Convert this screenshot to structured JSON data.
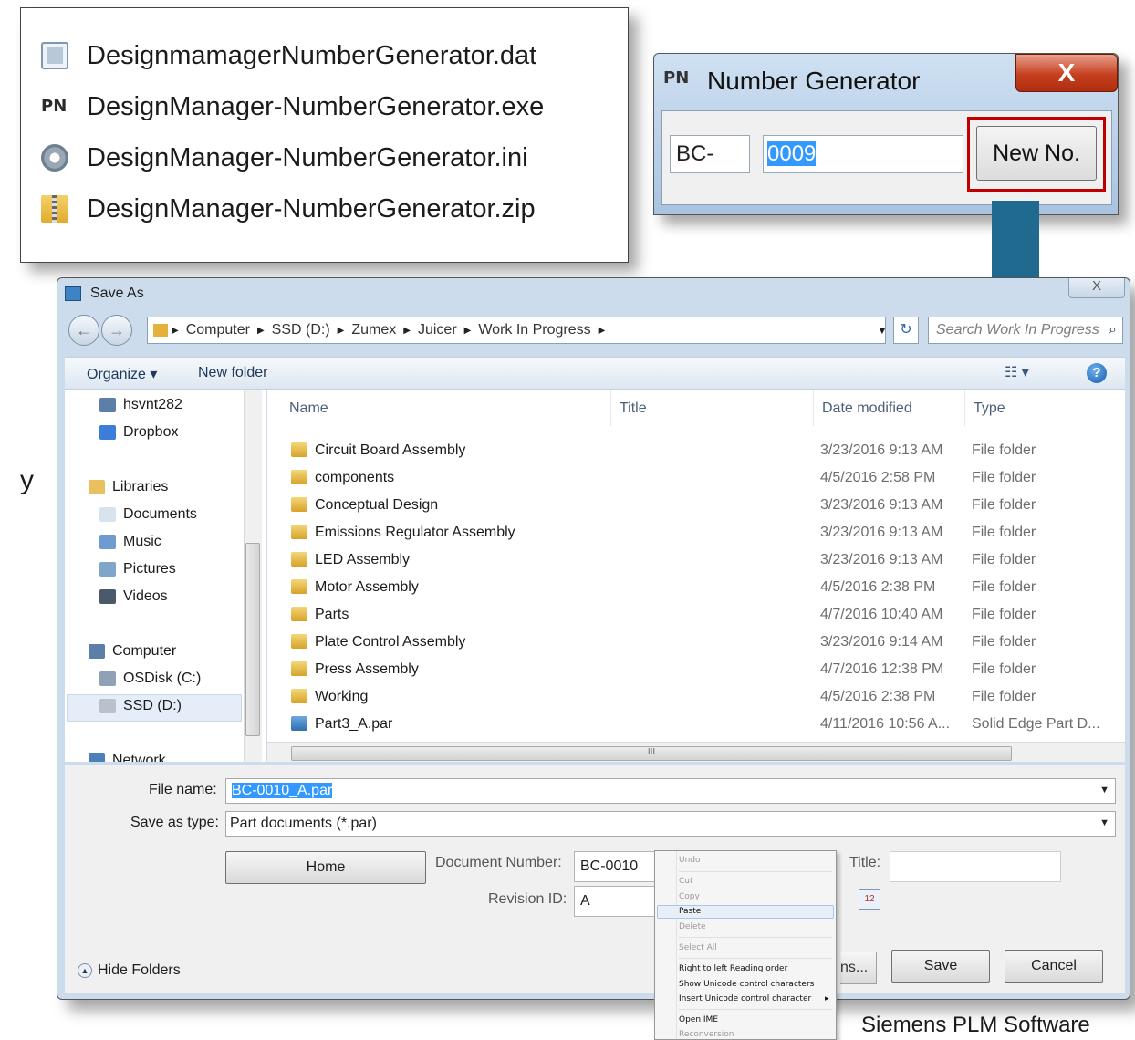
{
  "files": [
    {
      "name": "DesignmamagerNumberGenerator.dat",
      "icon": "dat-file-icon"
    },
    {
      "name": "DesignManager-NumberGenerator.exe",
      "icon": "pn-app-icon"
    },
    {
      "name": "DesignManager-NumberGenerator.ini",
      "icon": "settings-file-icon"
    },
    {
      "name": "DesignManager-NumberGenerator.zip",
      "icon": "zip-folder-icon"
    }
  ],
  "number_generator": {
    "title": "Number Generator",
    "logo": "PN",
    "close": "X",
    "prefix": "BC-",
    "number": "0009",
    "new_button": "New No."
  },
  "save_as": {
    "title": "Save As",
    "close": "X",
    "breadcrumb": [
      "Computer",
      "SSD (D:)",
      "Zumex",
      "Juicer",
      "Work In Progress"
    ],
    "search_placeholder": "Search Work In Progress",
    "toolbar": {
      "organize": "Organize ▾",
      "new_folder": "New folder"
    },
    "nav": [
      {
        "label": "hsvnt282"
      },
      {
        "label": "Dropbox"
      },
      {
        "label": "Libraries"
      },
      {
        "label": "Documents"
      },
      {
        "label": "Music"
      },
      {
        "label": "Pictures"
      },
      {
        "label": "Videos"
      },
      {
        "label": "Computer"
      },
      {
        "label": "OSDisk (C:)"
      },
      {
        "label": "SSD (D:)"
      },
      {
        "label": "Network"
      }
    ],
    "columns": {
      "name": "Name",
      "title": "Title",
      "date": "Date modified",
      "type": "Type"
    },
    "rows": [
      {
        "name": "Circuit Board Assembly",
        "date": "3/23/2016 9:13 AM",
        "type": "File folder"
      },
      {
        "name": "components",
        "date": "4/5/2016 2:58 PM",
        "type": "File folder"
      },
      {
        "name": "Conceptual Design",
        "date": "3/23/2016 9:13 AM",
        "type": "File folder"
      },
      {
        "name": "Emissions Regulator Assembly",
        "date": "3/23/2016 9:13 AM",
        "type": "File folder"
      },
      {
        "name": "LED Assembly",
        "date": "3/23/2016 9:13 AM",
        "type": "File folder"
      },
      {
        "name": "Motor Assembly",
        "date": "4/5/2016 2:38 PM",
        "type": "File folder"
      },
      {
        "name": "Parts",
        "date": "4/7/2016 10:40 AM",
        "type": "File folder"
      },
      {
        "name": "Plate Control Assembly",
        "date": "3/23/2016 9:14 AM",
        "type": "File folder"
      },
      {
        "name": "Press Assembly",
        "date": "4/7/2016 12:38 PM",
        "type": "File folder"
      },
      {
        "name": "Working",
        "date": "4/5/2016 2:38 PM",
        "type": "File folder"
      },
      {
        "name": "Part3_A.par",
        "date": "4/11/2016 10:56 A...",
        "type": "Solid Edge Part D..."
      }
    ],
    "hscroll_grip": "III",
    "file_name_label": "File name:",
    "file_name": "BC-0010_A.par",
    "save_type_label": "Save as type:",
    "save_type": "Part documents (*.par)",
    "home_button": "Home",
    "doc_number_label": "Document Number:",
    "doc_number": "BC-0010",
    "revision_label": "Revision ID:",
    "revision": "A",
    "title_label": "Title:",
    "title_value": "",
    "tools_button": "ns...",
    "save_button": "Save",
    "cancel_button": "Cancel",
    "hide_folders": "Hide Folders"
  },
  "context_menu": [
    {
      "label": "Undo",
      "enabled": false
    },
    {
      "label": "Cut",
      "enabled": false
    },
    {
      "label": "Copy",
      "enabled": false
    },
    {
      "label": "Paste",
      "enabled": true
    },
    {
      "label": "Delete",
      "enabled": false
    },
    {
      "label": "Select All",
      "enabled": false
    },
    {
      "label": "Right to left Reading order",
      "enabled": true
    },
    {
      "label": "Show Unicode control characters",
      "enabled": true
    },
    {
      "label": "Insert Unicode control character",
      "enabled": true
    },
    {
      "label": "Open IME",
      "enabled": true
    },
    {
      "label": "Reconversion",
      "enabled": false
    }
  ],
  "left_edge_text": "y",
  "footer": "Siemens PLM Software",
  "colors": {
    "arrow": "#1f6a8e",
    "highlight_frame": "#c00000",
    "selection": "#3399ff"
  }
}
